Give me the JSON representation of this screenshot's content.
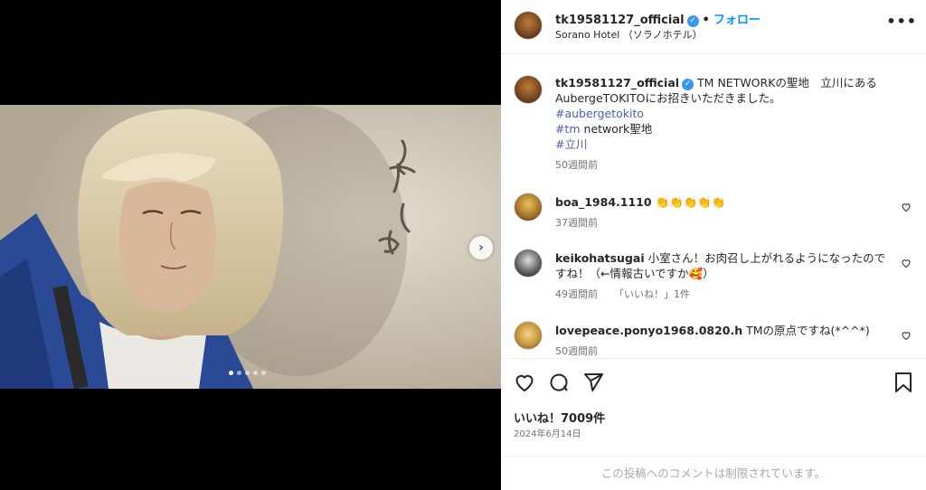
{
  "header": {
    "username": "tk19581127_official",
    "separator": "•",
    "follow_label": "フォロー",
    "location": "Sorano Hotel （ソラノホテル）",
    "more_label": "•••"
  },
  "caption": {
    "username": "tk19581127_official",
    "text_line1": "TM NETWORKの聖地　立川にある",
    "text_line2": "AubergeTOKITOにお招きいただきました。",
    "tag1": "#aubergetokito",
    "tag2": "#tm",
    "tag2_rest": " network聖地",
    "tag3": "#立川",
    "time": "50週間前"
  },
  "comments": [
    {
      "username": "boa_1984.1110",
      "text": "👏👏👏👏👏",
      "time": "37週間前"
    },
    {
      "username": "keikohatsugai",
      "text": "小室さん！お肉召し上がれるようになったのですね！（←情報古いですか🥰）",
      "time": "49週間前",
      "likes": "「いいね！」1件"
    },
    {
      "username": "lovepeace.ponyo1968.0820.h",
      "text": "TMの原点ですね(*^^*)",
      "time": "50週間前"
    }
  ],
  "stats": {
    "likes": "いいね！7009件",
    "date": "2024年6月14日"
  },
  "footer": {
    "restricted": "この投稿へのコメントは制限されています。"
  },
  "media": {
    "carousel_dots": 5,
    "active_dot": 0,
    "next_arrow": "›"
  },
  "colors": {
    "accent": "#0095f6",
    "hashtag": "#4a5eb2",
    "verified": "#3897f0",
    "muted": "#737373"
  }
}
